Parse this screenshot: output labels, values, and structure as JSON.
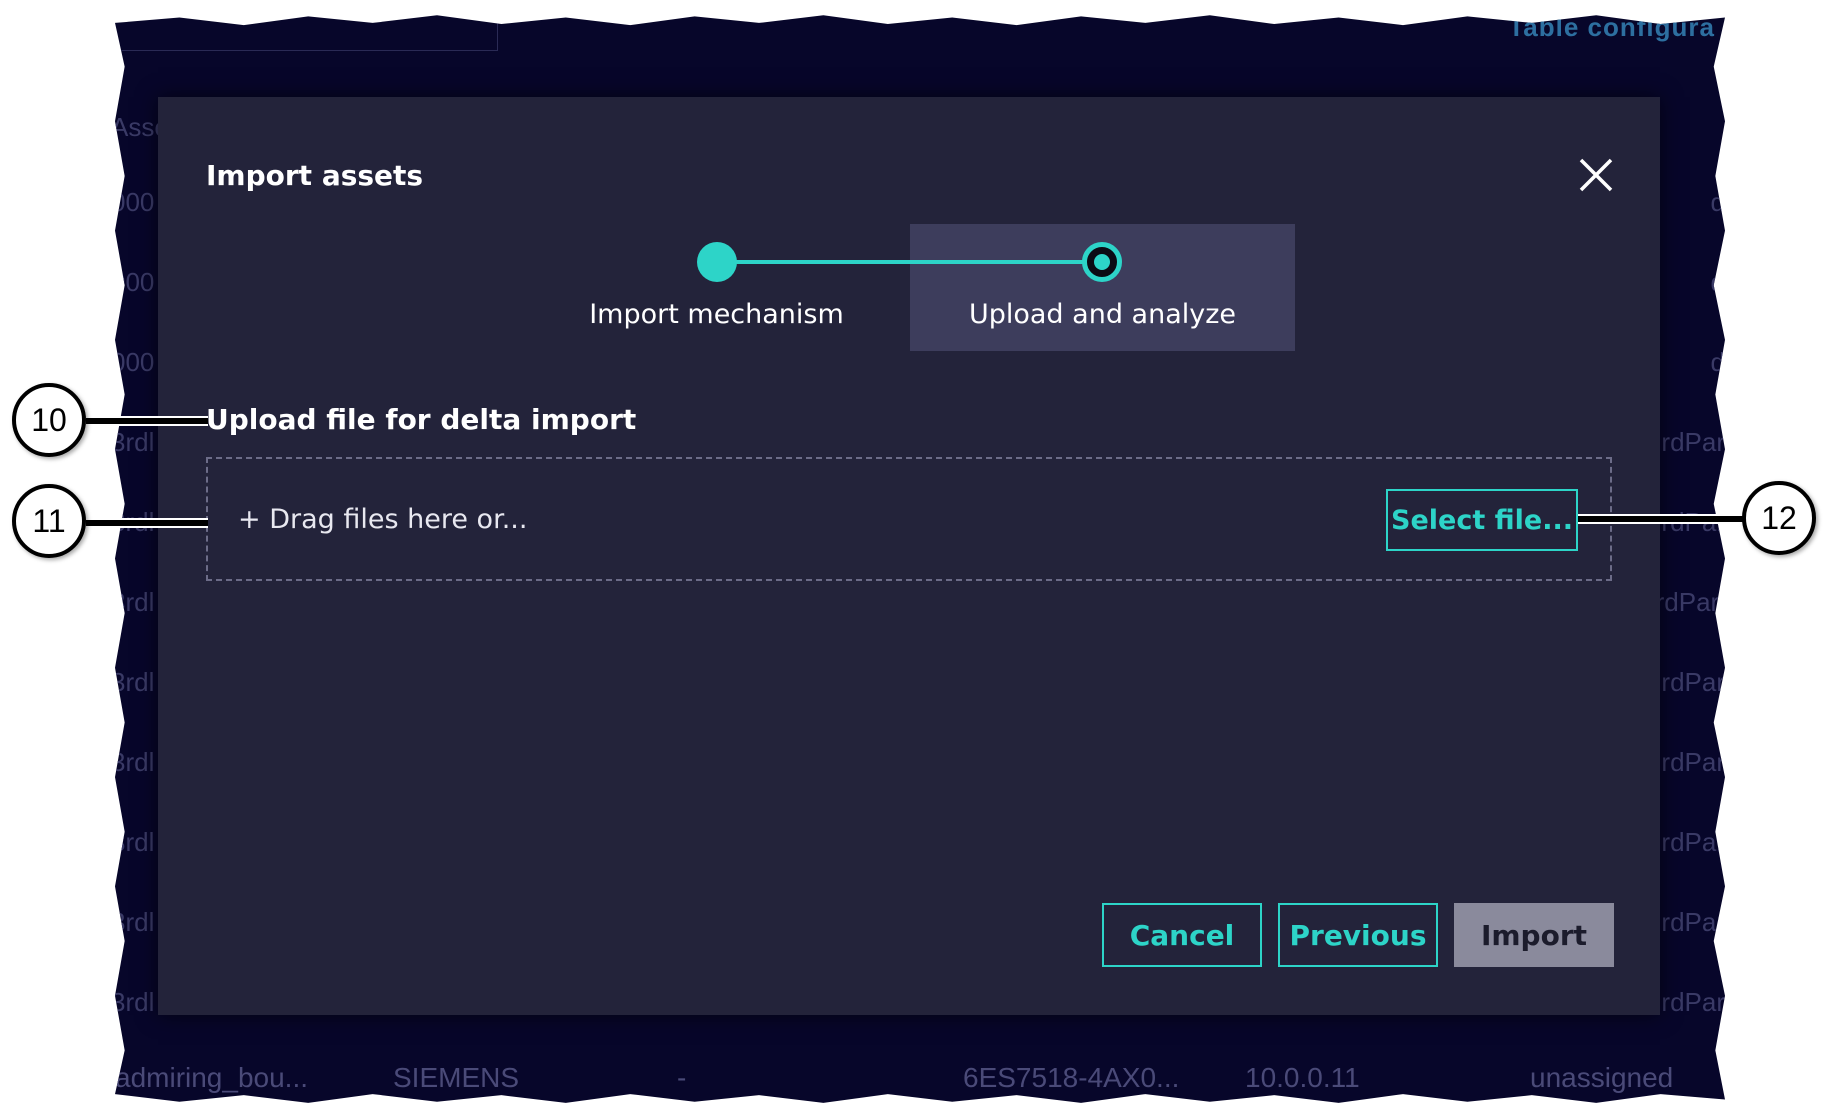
{
  "background": {
    "top_right_text": "Table configura",
    "left_column": [
      "Asse",
      "000",
      "000",
      "000",
      "3rdl",
      "3rdl",
      "3rdl",
      "3rdl",
      "3rdl",
      "3rdl",
      "3rdl",
      "3rdl"
    ],
    "right_column": [
      "d",
      "d",
      "d",
      "rdPar",
      "rdPar",
      "rdPar.",
      "rdPar",
      "rdPar",
      "rdPar",
      "rdPar",
      "rdPar"
    ],
    "bottom_row": {
      "name": "admiring_bou...",
      "vendor": "SIEMENS",
      "dash": "-",
      "order_number": "6ES7518-4AX0...",
      "ip": "10.0.0.11",
      "status": "unassigned"
    }
  },
  "modal": {
    "title": "Import assets",
    "close_icon": "close-icon",
    "steps": [
      {
        "label": "Import mechanism",
        "state": "completed"
      },
      {
        "label": "Upload and analyze",
        "state": "current"
      }
    ],
    "section_title": "Upload file for delta import",
    "dropzone_text": "+ Drag files here or...",
    "select_file_label": "Select file...",
    "buttons": {
      "cancel": "Cancel",
      "previous": "Previous",
      "import": "Import"
    }
  },
  "callouts": [
    "10",
    "11",
    "12"
  ],
  "colors": {
    "accent": "#2dd4c8",
    "modal_bg": "#23233a",
    "backdrop": "#07062a",
    "step_highlight": "#3d3d5c",
    "disabled_button": "#8a8a9c"
  }
}
